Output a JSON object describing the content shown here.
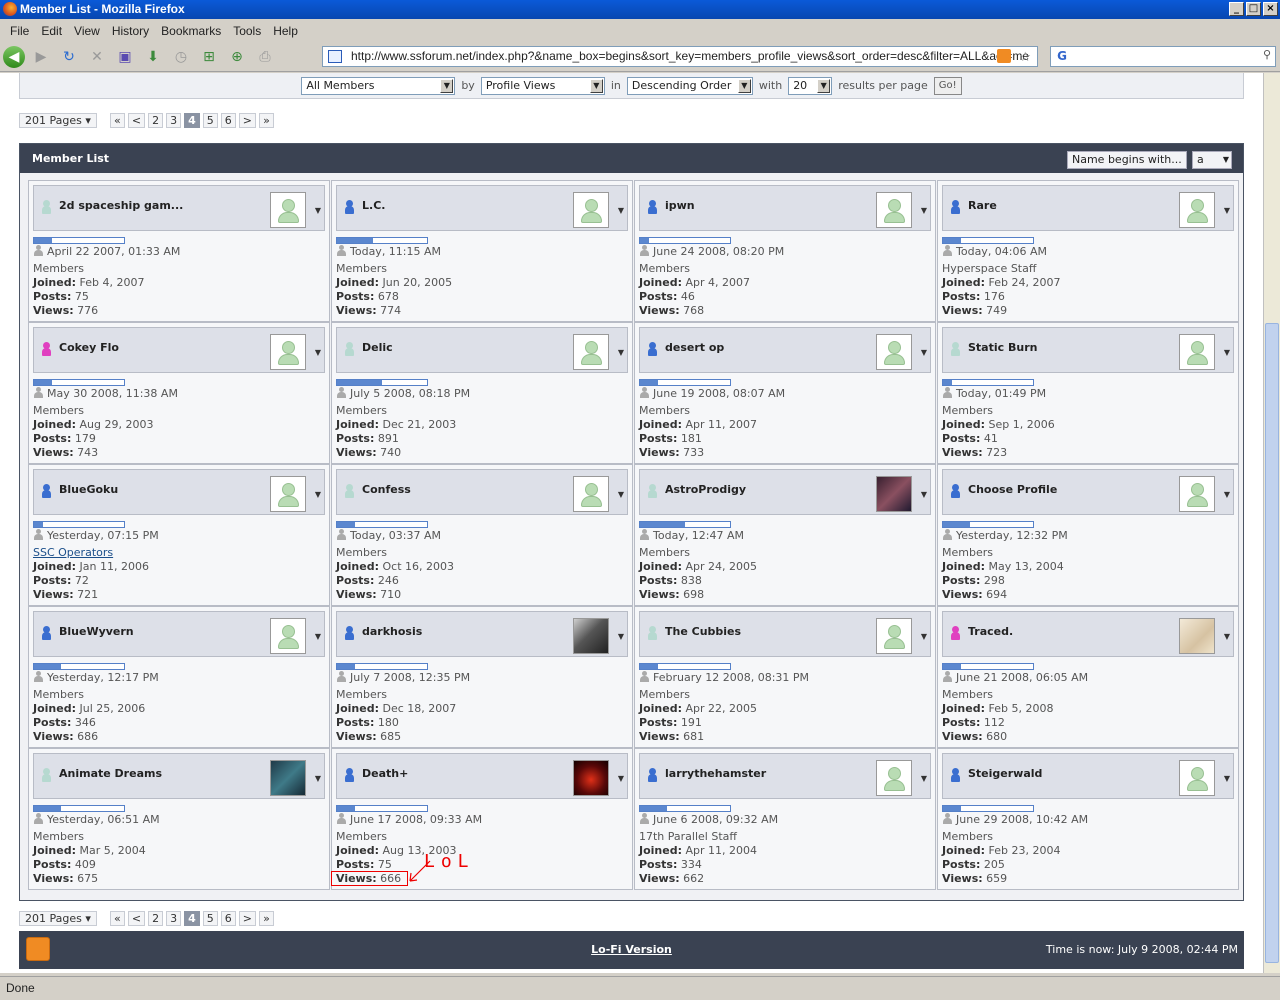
{
  "window": {
    "title": "Member List - Mozilla Firefox"
  },
  "menu": [
    "File",
    "Edit",
    "View",
    "History",
    "Bookmarks",
    "Tools",
    "Help"
  ],
  "address": {
    "url": "http://www.ssforum.net/index.php?&name_box=begins&sort_key=members_profile_views&sort_order=desc&filter=ALL&act=me"
  },
  "filter": {
    "group": "All Members",
    "by_label": "by",
    "sort_key": "Profile Views",
    "in_label": "in",
    "order": "Descending Order",
    "with_label": "with",
    "per_page": "20",
    "results_label": "results per page",
    "go": "Go!"
  },
  "pager": {
    "total": "201 Pages",
    "first": "«",
    "prev": "<",
    "pages": [
      "2",
      "3",
      "4",
      "5",
      "6"
    ],
    "current": "4",
    "next": ">",
    "last": "»"
  },
  "member_list": {
    "title": "Member List",
    "name_begins": "Name begins with...",
    "letter": "a"
  },
  "labels": {
    "joined": "Joined:",
    "posts": "Posts:",
    "views": "Views:"
  },
  "members": [
    {
      "name": "2d spaceship gam...",
      "last": "April 22 2007, 01:33 AM",
      "group": "Members",
      "joined": "Feb 4, 2007",
      "posts": "75",
      "views": "776",
      "bar": 0.2,
      "pin": "#b6d9d0",
      "avatar": "default"
    },
    {
      "name": "L.C.",
      "last": "Today, 11:15 AM",
      "group": "Members",
      "joined": "Jun 20, 2005",
      "posts": "678",
      "views": "774",
      "bar": 0.4,
      "pin": "#3a6ed0",
      "avatar": "default"
    },
    {
      "name": "ipwn",
      "last": "June 24 2008, 08:20 PM",
      "group": "Members",
      "joined": "Apr 4, 2007",
      "posts": "46",
      "views": "768",
      "bar": 0.1,
      "pin": "#3a6ed0",
      "avatar": "default"
    },
    {
      "name": "Rare",
      "last": "Today, 04:06 AM",
      "group": "Hyperspace Staff",
      "joined": "Feb 24, 2007",
      "posts": "176",
      "views": "749",
      "bar": 0.2,
      "pin": "#3a6ed0",
      "avatar": "default"
    },
    {
      "name": "Cokey Flo",
      "last": "May 30 2008, 11:38 AM",
      "group": "Members",
      "joined": "Aug 29, 2003",
      "posts": "179",
      "views": "743",
      "bar": 0.2,
      "pin": "#e040c0",
      "avatar": "default"
    },
    {
      "name": "Delic",
      "last": "July 5 2008, 08:18 PM",
      "group": "Members",
      "joined": "Dec 21, 2003",
      "posts": "891",
      "views": "740",
      "bar": 0.5,
      "pin": "#b6d9d0",
      "avatar": "default"
    },
    {
      "name": "desert op",
      "last": "June 19 2008, 08:07 AM",
      "group": "Members",
      "joined": "Apr 11, 2007",
      "posts": "181",
      "views": "733",
      "bar": 0.2,
      "pin": "#3a6ed0",
      "avatar": "default"
    },
    {
      "name": "Static Burn",
      "last": "Today, 01:49 PM",
      "group": "Members",
      "joined": "Sep 1, 2006",
      "posts": "41",
      "views": "723",
      "bar": 0.1,
      "pin": "#b6d9d0",
      "avatar": "default"
    },
    {
      "name": "BlueGoku",
      "last": "Yesterday, 07:15 PM",
      "group": "SSC Operators",
      "group_link": true,
      "joined": "Jan 11, 2006",
      "posts": "72",
      "views": "721",
      "bar": 0.1,
      "pin": "#3a6ed0",
      "avatar": "default"
    },
    {
      "name": "Confess",
      "last": "Today, 03:37 AM",
      "group": "Members",
      "joined": "Oct 16, 2003",
      "posts": "246",
      "views": "710",
      "bar": 0.2,
      "pin": "#b6d9d0",
      "avatar": "default"
    },
    {
      "name": "AstroProdigy",
      "last": "Today, 12:47 AM",
      "group": "Members",
      "joined": "Apr 24, 2005",
      "posts": "838",
      "views": "698",
      "bar": 0.5,
      "pin": "#b6d9d0",
      "avatar": "dark1"
    },
    {
      "name": "Choose Profile",
      "last": "Yesterday, 12:32 PM",
      "group": "Members",
      "joined": "May 13, 2004",
      "posts": "298",
      "views": "694",
      "bar": 0.3,
      "pin": "#3a6ed0",
      "avatar": "default"
    },
    {
      "name": "BlueWyvern",
      "last": "Yesterday, 12:17 PM",
      "group": "Members",
      "joined": "Jul 25, 2006",
      "posts": "346",
      "views": "686",
      "bar": 0.3,
      "pin": "#3a6ed0",
      "avatar": "default"
    },
    {
      "name": "darkhosis",
      "last": "July 7 2008, 12:35 PM",
      "group": "Members",
      "joined": "Dec 18, 2007",
      "posts": "180",
      "views": "685",
      "bar": 0.2,
      "pin": "#3a6ed0",
      "avatar": "dark2"
    },
    {
      "name": "The Cubbies",
      "last": "February 12 2008, 08:31 PM",
      "group": "Members",
      "joined": "Apr 22, 2005",
      "posts": "191",
      "views": "681",
      "bar": 0.2,
      "pin": "#b6d9d0",
      "avatar": "default"
    },
    {
      "name": "Traced.",
      "last": "June 21 2008, 06:05 AM",
      "group": "Members",
      "joined": "Feb 5, 2008",
      "posts": "112",
      "views": "680",
      "bar": 0.2,
      "pin": "#e040c0",
      "avatar": "sketch"
    },
    {
      "name": "Animate Dreams",
      "last": "Yesterday, 06:51 AM",
      "group": "Members",
      "joined": "Mar 5, 2004",
      "posts": "409",
      "views": "675",
      "bar": 0.3,
      "pin": "#b6d9d0",
      "avatar": "teal"
    },
    {
      "name": "Death+",
      "last": "June 17 2008, 09:33 AM",
      "group": "Members",
      "joined": "Aug 13, 2003",
      "posts": "75",
      "views": "666",
      "bar": 0.2,
      "pin": "#3a6ed0",
      "avatar": "red"
    },
    {
      "name": "larrythehamster",
      "last": "June 6 2008, 09:32 AM",
      "group": "17th Parallel Staff",
      "joined": "Apr 11, 2004",
      "posts": "334",
      "views": "662",
      "bar": 0.3,
      "pin": "#3a6ed0",
      "avatar": "default"
    },
    {
      "name": "Steigerwald",
      "last": "June 29 2008, 10:42 AM",
      "group": "Members",
      "joined": "Feb 23, 2004",
      "posts": "205",
      "views": "659",
      "bar": 0.2,
      "pin": "#3a6ed0",
      "avatar": "default"
    }
  ],
  "annotation": {
    "text": "LoL",
    "color": "#e00000"
  },
  "footer": {
    "lofi": "Lo-Fi Version",
    "time": "Time is now: July 9 2008, 02:44 PM"
  },
  "status": "Done"
}
